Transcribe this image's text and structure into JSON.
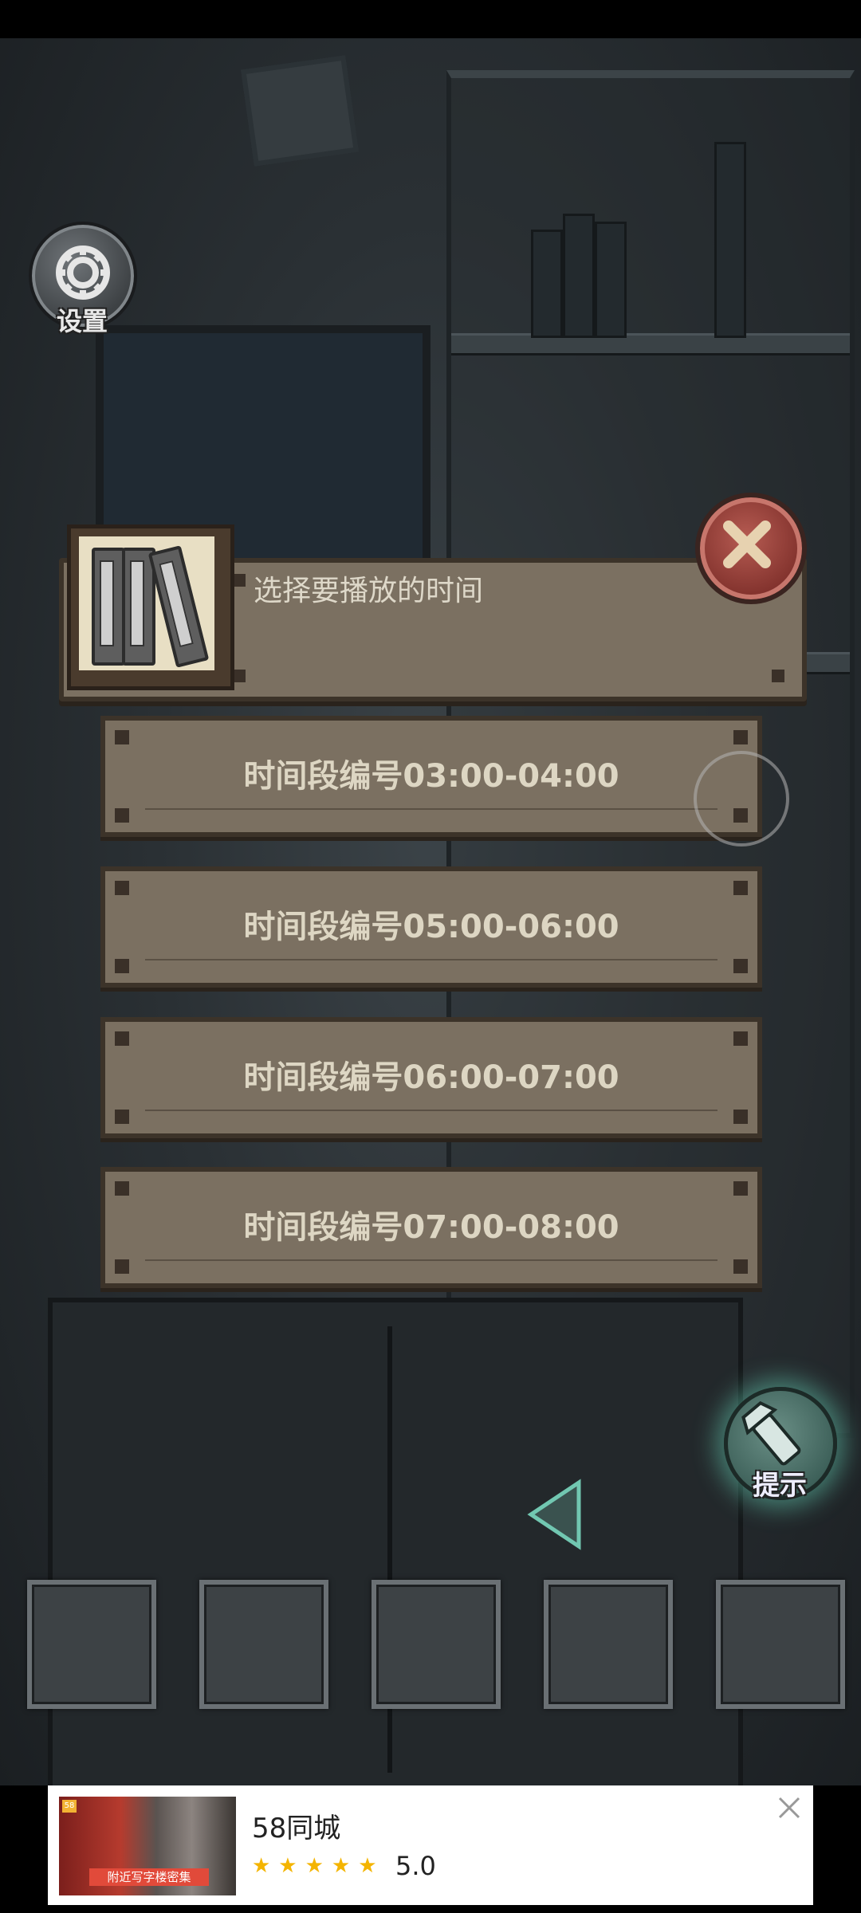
{
  "settings": {
    "label": "设置",
    "icon": "gear-icon"
  },
  "dialog": {
    "title": "选择要播放的时间",
    "icon": "binders-icon"
  },
  "options": [
    {
      "label": "时间段编号03:00-04:00"
    },
    {
      "label": "时间段编号05:00-06:00"
    },
    {
      "label": "时间段编号06:00-07:00"
    },
    {
      "label": "时间段编号07:00-08:00"
    }
  ],
  "hint": {
    "label": "提示",
    "icon": "flashlight-icon"
  },
  "inventory": {
    "slot_count": 5
  },
  "ad": {
    "title": "58同城",
    "rating": "5.0",
    "stars": 5,
    "thumb_badge": "58",
    "thumb_caption": "附近写字楼密集"
  },
  "colors": {
    "panel": "#7b7061",
    "panel_border": "#3c3329",
    "panel_text": "#ddd6c3",
    "close_red": "#7e2f2a",
    "hint_glow": "#6ee6c8"
  }
}
